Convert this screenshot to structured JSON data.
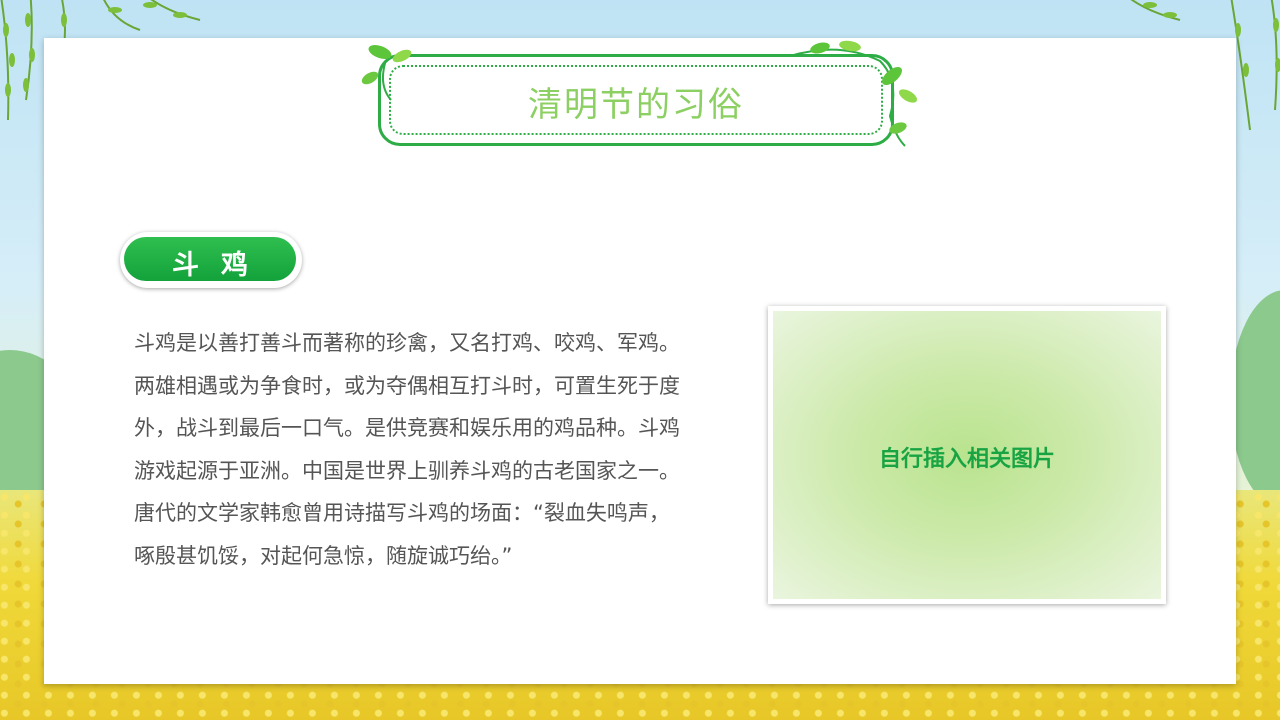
{
  "slide": {
    "title": "清明节的习俗",
    "section_label": "斗鸡",
    "body": "斗鸡是以善打善斗而著称的珍禽，又名打鸡、咬鸡、军鸡。两雄相遇或为争食时，或为夺偶相互打斗时，可置生死于度外，战斗到最后一口气。是供竞赛和娱乐用的鸡品种。斗鸡游戏起源于亚洲。中国是世界上驯养斗鸡的古老国家之一。唐代的文学家韩愈曾用诗描写斗鸡的场面：“裂血失鸣声，啄殷甚饥馁，对起何急惊，随旋诚巧绐。”",
    "image_placeholder": "自行插入相关图片"
  },
  "colors": {
    "accent_green": "#2eac45",
    "title_green": "#8ccf62",
    "pill_green": "#13a23b",
    "body_text": "#555555"
  },
  "icons": [
    "willow-branch-icon",
    "vine-leaf-icon"
  ]
}
